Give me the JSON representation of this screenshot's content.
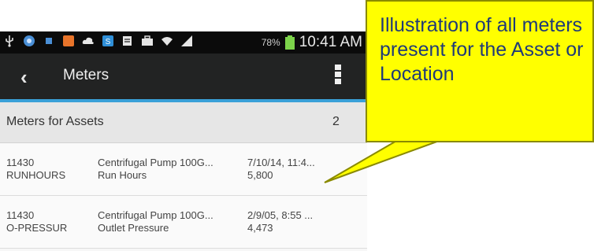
{
  "status_bar": {
    "icons": [
      "usb-icon",
      "circle-icon",
      "square-icon",
      "orange-app-icon",
      "cloud-icon",
      "s-app-icon",
      "doc-icon",
      "briefcase-icon",
      "wifi-icon",
      "signal-icon",
      "battery-icon"
    ],
    "battery": "78%",
    "time": "10:41 AM"
  },
  "action_bar": {
    "title": "Meters",
    "accent": "#3aa0d8"
  },
  "section": {
    "title": "Meters for Assets",
    "count": "2"
  },
  "meters": [
    {
      "id": "11430",
      "code": "RUNHOURS",
      "asset": "Centrifugal Pump 100G...",
      "name": "Run Hours",
      "date": "7/10/14, 11:4...",
      "reading": "5,800"
    },
    {
      "id": "11430",
      "code": "O-PRESSUR",
      "asset": "Centrifugal Pump 100G...",
      "name": "Outlet Pressure",
      "date": "2/9/05, 8:55 ...",
      "reading": "4,473"
    }
  ],
  "callout": {
    "text": "Illustration of all meters present for the Asset or Location",
    "color": "#ffff00"
  }
}
